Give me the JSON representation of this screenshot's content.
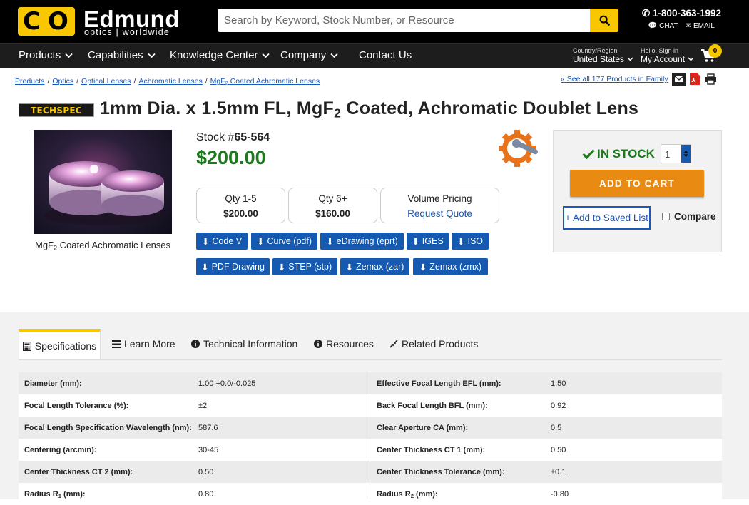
{
  "header": {
    "logo_name": "Edmund",
    "logo_sub": "optics | worldwide",
    "search_placeholder": "Search by Keyword, Stock Number, or Resource",
    "phone": "1-800-363-1992",
    "chat": "CHAT",
    "email": "EMAIL"
  },
  "nav": {
    "items": [
      "Products",
      "Capabilities",
      "Knowledge Center",
      "Company",
      "Contact Us"
    ],
    "country_label": "Country/Region",
    "country_value": "United States",
    "account_label": "Hello, Sign in",
    "account_value": "My Account",
    "cart_count": "0"
  },
  "breadcrumbs": [
    "Products",
    "Optics",
    "Optical Lenses",
    "Achromatic Lenses",
    "MgF",
    "2",
    " Coated Achromatic Lenses"
  ],
  "see_all": "See all 177 Products in Family",
  "product": {
    "badge": "TECHSPEC",
    "title_a": "1mm Dia. x 1.5mm FL, MgF",
    "title_sub": "2",
    "title_b": " Coated, Achromatic Doublet Lens",
    "caption_a": "MgF",
    "caption_sub": "2",
    "caption_b": " Coated Achromatic Lenses",
    "stock_label": "Stock #",
    "stock_no": "65-564",
    "price": "$200.00"
  },
  "pricing": [
    {
      "label": "Qty 1-5",
      "value": "$200.00"
    },
    {
      "label": "Qty 6+",
      "value": "$160.00"
    },
    {
      "label": "Volume Pricing",
      "value": "Request Quote"
    }
  ],
  "downloads": [
    "Code V",
    "Curve (pdf)",
    "eDrawing (eprt)",
    "IGES",
    "ISO",
    "PDF Drawing",
    "STEP (stp)",
    "Zemax (zar)",
    "Zemax (zmx)"
  ],
  "cart_panel": {
    "status": "IN STOCK",
    "qty": "1",
    "add_to_cart": "ADD TO CART",
    "saved_list": "+ Add to Saved List",
    "compare": "Compare"
  },
  "tabs": [
    "Specifications",
    "Learn More",
    "Technical Information",
    "Resources",
    "Related Products"
  ],
  "specs": [
    {
      "k": "Diameter (mm):",
      "v": "1.00 +0.0/-0.025",
      "k2": "Effective Focal Length EFL (mm):",
      "v2": "1.50"
    },
    {
      "k": "Focal Length Tolerance (%):",
      "v": "±2",
      "k2": "Back Focal Length BFL (mm):",
      "v2": "0.92"
    },
    {
      "k": "Focal Length Specification Wavelength (nm):",
      "v": "587.6",
      "k2": "Clear Aperture CA (mm):",
      "v2": "0.5"
    },
    {
      "k": "Centering (arcmin):",
      "v": "30-45",
      "k2": "Center Thickness CT 1 (mm):",
      "v2": "0.50"
    },
    {
      "k": "Center Thickness CT 2 (mm):",
      "v": "0.50",
      "k2": "Center Thickness Tolerance (mm):",
      "v2": "±0.1"
    },
    {
      "k": "Radius R",
      "ksub": "1",
      "kend": " (mm):",
      "v": "0.80",
      "k2": "Radius R",
      "k2sub": "2",
      "k2end": " (mm):",
      "v2": "-0.80"
    }
  ],
  "colors": {
    "brand_yellow": "#f9c700",
    "link_blue": "#1b57b8",
    "button_blue": "#1559b0",
    "price_green": "#1e7a1e",
    "cart_orange": "#e98a13"
  }
}
